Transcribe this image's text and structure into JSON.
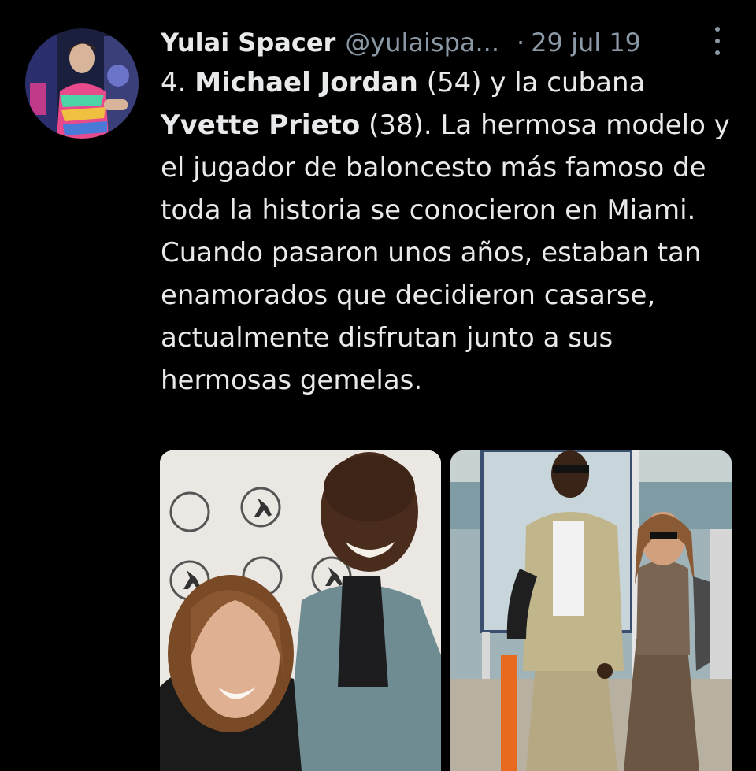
{
  "author": {
    "display_name": "Yulai Spacer",
    "handle": "@yulaispa...",
    "separator": "·",
    "date": "29 jul 19"
  },
  "tweet": {
    "number": "4.",
    "name1": "Michael Jordan",
    "age1": "(54) y la cubana",
    "name2": "Yvette Prieto",
    "rest": "(38). La hermosa modelo y el jugador de baloncesto más famoso de toda la historia se conocieron en Miami. Cuando pasaron unos años, estaban tan enamorados que decidieron casarse, actualmente disfrutan junto a sus hermosas gemelas."
  },
  "icons": {
    "more": "more-options-icon"
  },
  "colors": {
    "background": "#000000",
    "text": "#e7e9ea",
    "muted": "#8b98a5"
  }
}
